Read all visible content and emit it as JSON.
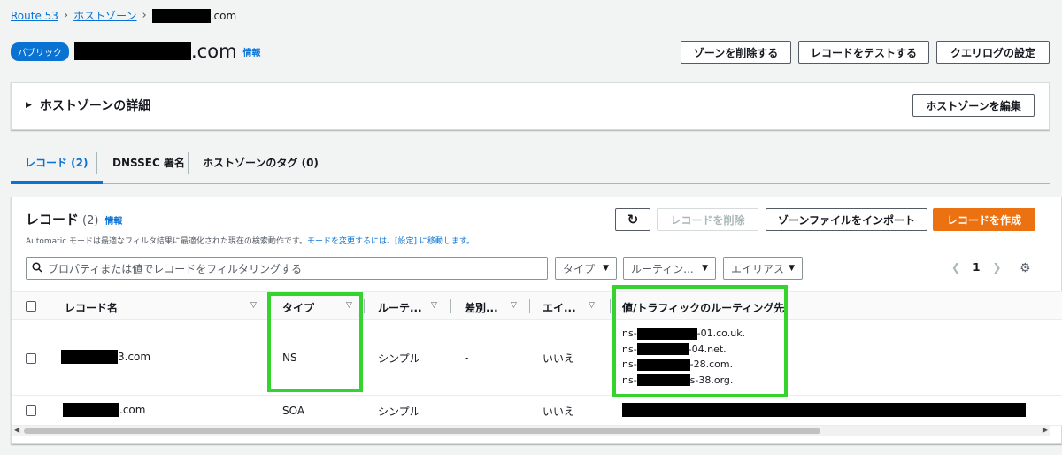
{
  "breadcrumb": {
    "root": "Route 53",
    "zones": "ホストゾーン",
    "current_suffix": ".com"
  },
  "header": {
    "badge": "パブリック",
    "domain_suffix": ".com",
    "info": "情報"
  },
  "actions": {
    "delete_zone": "ゾーンを削除する",
    "test_record": "レコードをテストする",
    "query_log": "クエリログの設定"
  },
  "details": {
    "title": "ホストゾーンの詳細",
    "edit_button": "ホストゾーンを編集"
  },
  "tabs": [
    {
      "label": "レコード (2)"
    },
    {
      "label": "DNSSEC 署名"
    },
    {
      "label": "ホストゾーンのタグ (0)"
    }
  ],
  "records": {
    "title": "レコード",
    "count": "(2)",
    "info": "情報",
    "refresh_icon": "refresh-icon",
    "delete_button": "レコードを削除",
    "import_button": "ゾーンファイルをインポート",
    "create_button": "レコードを作成",
    "description_prefix": "Automatic モードは最適なフィルタ結果に最適化された現在の検索動作です。",
    "description_link": "モードを変更するには、[設定] に移動します。",
    "search_placeholder": "プロパティまたは値でレコードをフィルタリングする",
    "filters": {
      "type": "タイプ",
      "routing": "ルーティン...",
      "alias": "エイリアス"
    },
    "page": "1"
  },
  "columns": {
    "name": "レコード名",
    "type": "タイプ",
    "routing": "ルーテ...",
    "diff": "差別...",
    "alias": "エイ...",
    "value": "値/トラフィックのルーティング先"
  },
  "rows": [
    {
      "name_suffix": "3.com",
      "type": "NS",
      "routing": "シンプル",
      "diff": "-",
      "alias": "いいえ",
      "values": [
        {
          "prefix": "ns-",
          "suffix": "-01.co.uk."
        },
        {
          "prefix": "ns-",
          "suffix": "-04.net."
        },
        {
          "prefix": "ns-",
          "suffix": "-28.com."
        },
        {
          "prefix": "ns-",
          "suffix": "s-38.org."
        }
      ]
    },
    {
      "name_suffix": ".com",
      "type": "SOA",
      "routing": "シンプル",
      "diff": "",
      "alias": "いいえ"
    }
  ],
  "colors": {
    "link": "#0972d3",
    "primary": "#ec7211",
    "highlight": "#35d32d"
  }
}
